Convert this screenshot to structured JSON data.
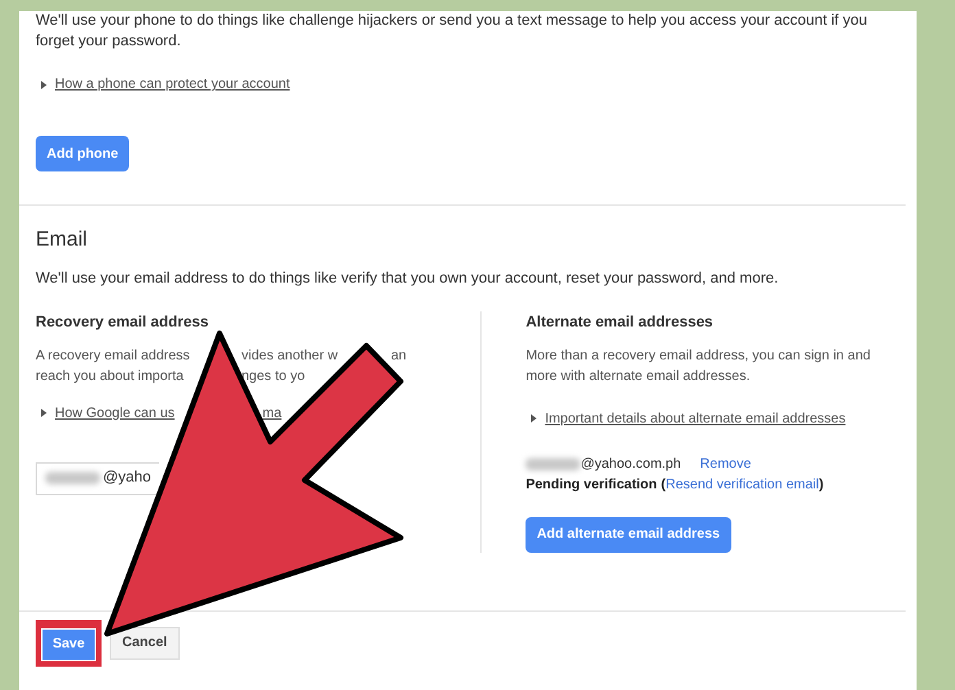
{
  "phone": {
    "description": "We'll use your phone to do things like challenge hijackers or send you a text message to help you access your account if you forget your password.",
    "help_link": "How a phone can protect your account",
    "button": "Add phone"
  },
  "email": {
    "heading": "Email",
    "description": "We'll use your email address to do things like verify that you own your account, reset your password, and more.",
    "recovery": {
      "heading": "Recovery email address",
      "description_lines": [
        [
          "A recovery email address",
          "vides another w",
          "an"
        ],
        [
          "reach you about importa",
          "nges to yo"
        ]
      ],
      "help_link": [
        "How Google can us",
        "ma"
      ],
      "field_value": "@yaho"
    },
    "alternate": {
      "heading": "Alternate email addresses",
      "description": "More than a recovery email address, you can sign in and more with alternate email addresses.",
      "help_link": "Important details about alternate email addresses",
      "address": "@yahoo.com.ph",
      "remove_link": "Remove",
      "pending": "Pending verification",
      "pending_open": "(",
      "resend_link": "Resend verification email",
      "pending_close": ")",
      "button": "Add alternate email address"
    }
  },
  "footer": {
    "save": "Save",
    "cancel": "Cancel",
    "save_highlighted": true
  }
}
